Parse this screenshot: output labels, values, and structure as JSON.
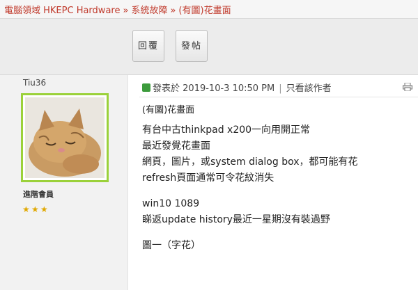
{
  "breadcrumb": {
    "site": "電腦領域 HKEPC Hardware",
    "forum": "系統故障",
    "thread": "(有圖)花畫面",
    "separator": "»"
  },
  "toolbar": {
    "reply_label": "回覆",
    "post_label": "發帖"
  },
  "author": {
    "username": "Tiu36",
    "group": "進階會員",
    "stars": 3
  },
  "post": {
    "posted_prefix": "發表於",
    "datetime": "2019-10-3 10:50 PM",
    "only_author": "只看該作者",
    "title": "(有圖)花畫面",
    "body": [
      "有台中古thinkpad x200一向用開正常",
      "最近發覺花畫面",
      "網頁，圖片，或system dialog box，都可能有花",
      "refresh頁面通常可令花紋消失",
      "",
      "win10 1089",
      "睇返update history最近一星期沒有裝過野",
      "",
      "圖一（字花）"
    ]
  },
  "colors": {
    "breadcrumb": "#c0392b",
    "avatar_border": "#9bd13a",
    "star": "#e0a800"
  },
  "icons": {
    "post_flag": "post-flag-icon",
    "print": "print-icon",
    "avatar": "cat-avatar"
  }
}
